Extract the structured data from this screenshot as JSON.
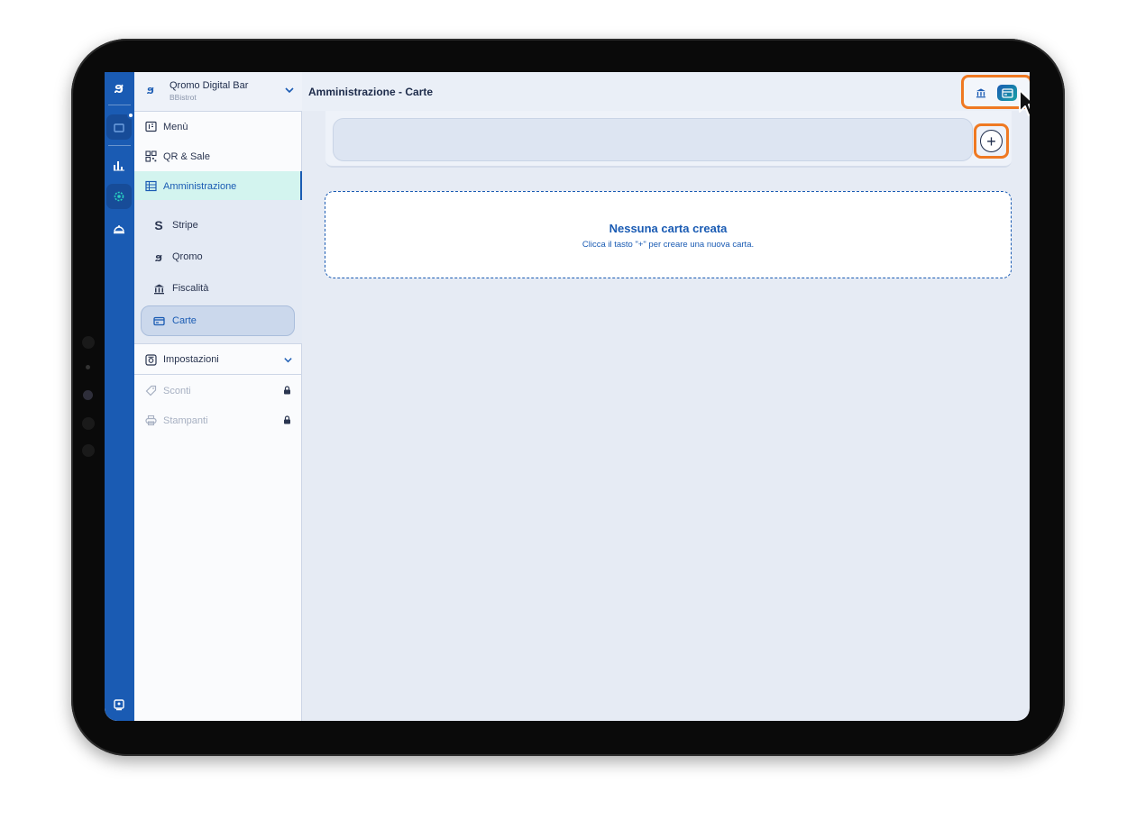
{
  "app": {
    "logo_glyph": "ϧ",
    "accent": "#1a5bb3",
    "highlight": "#ef7922"
  },
  "venue": {
    "name": "Qromo Digital Bar",
    "subtitle": "BBistrot"
  },
  "sidebar": {
    "items": [
      {
        "label": "Menù",
        "icon": "menu-book-icon"
      },
      {
        "label": "QR & Sale",
        "icon": "qr-code-icon"
      },
      {
        "label": "Amministrazione",
        "icon": "admin-grid-icon",
        "active": true
      }
    ],
    "subitems": [
      {
        "label": "Stripe",
        "icon": "stripe-icon"
      },
      {
        "label": "Qromo",
        "icon": "qromo-icon"
      },
      {
        "label": "Fiscalità",
        "icon": "bank-icon"
      },
      {
        "label": "Carte",
        "icon": "card-icon",
        "selected": true
      }
    ],
    "settings": {
      "label": "Impostazioni"
    },
    "locked": [
      {
        "label": "Sconti",
        "icon": "tag-icon"
      },
      {
        "label": "Stampanti",
        "icon": "printer-icon"
      }
    ]
  },
  "header": {
    "title": "Amministrazione - Carte"
  },
  "add_button": {
    "symbol": "+"
  },
  "empty_state": {
    "title": "Nessuna carta creata",
    "message": "Clicca il tasto \"+\" per creare una nuova carta."
  }
}
